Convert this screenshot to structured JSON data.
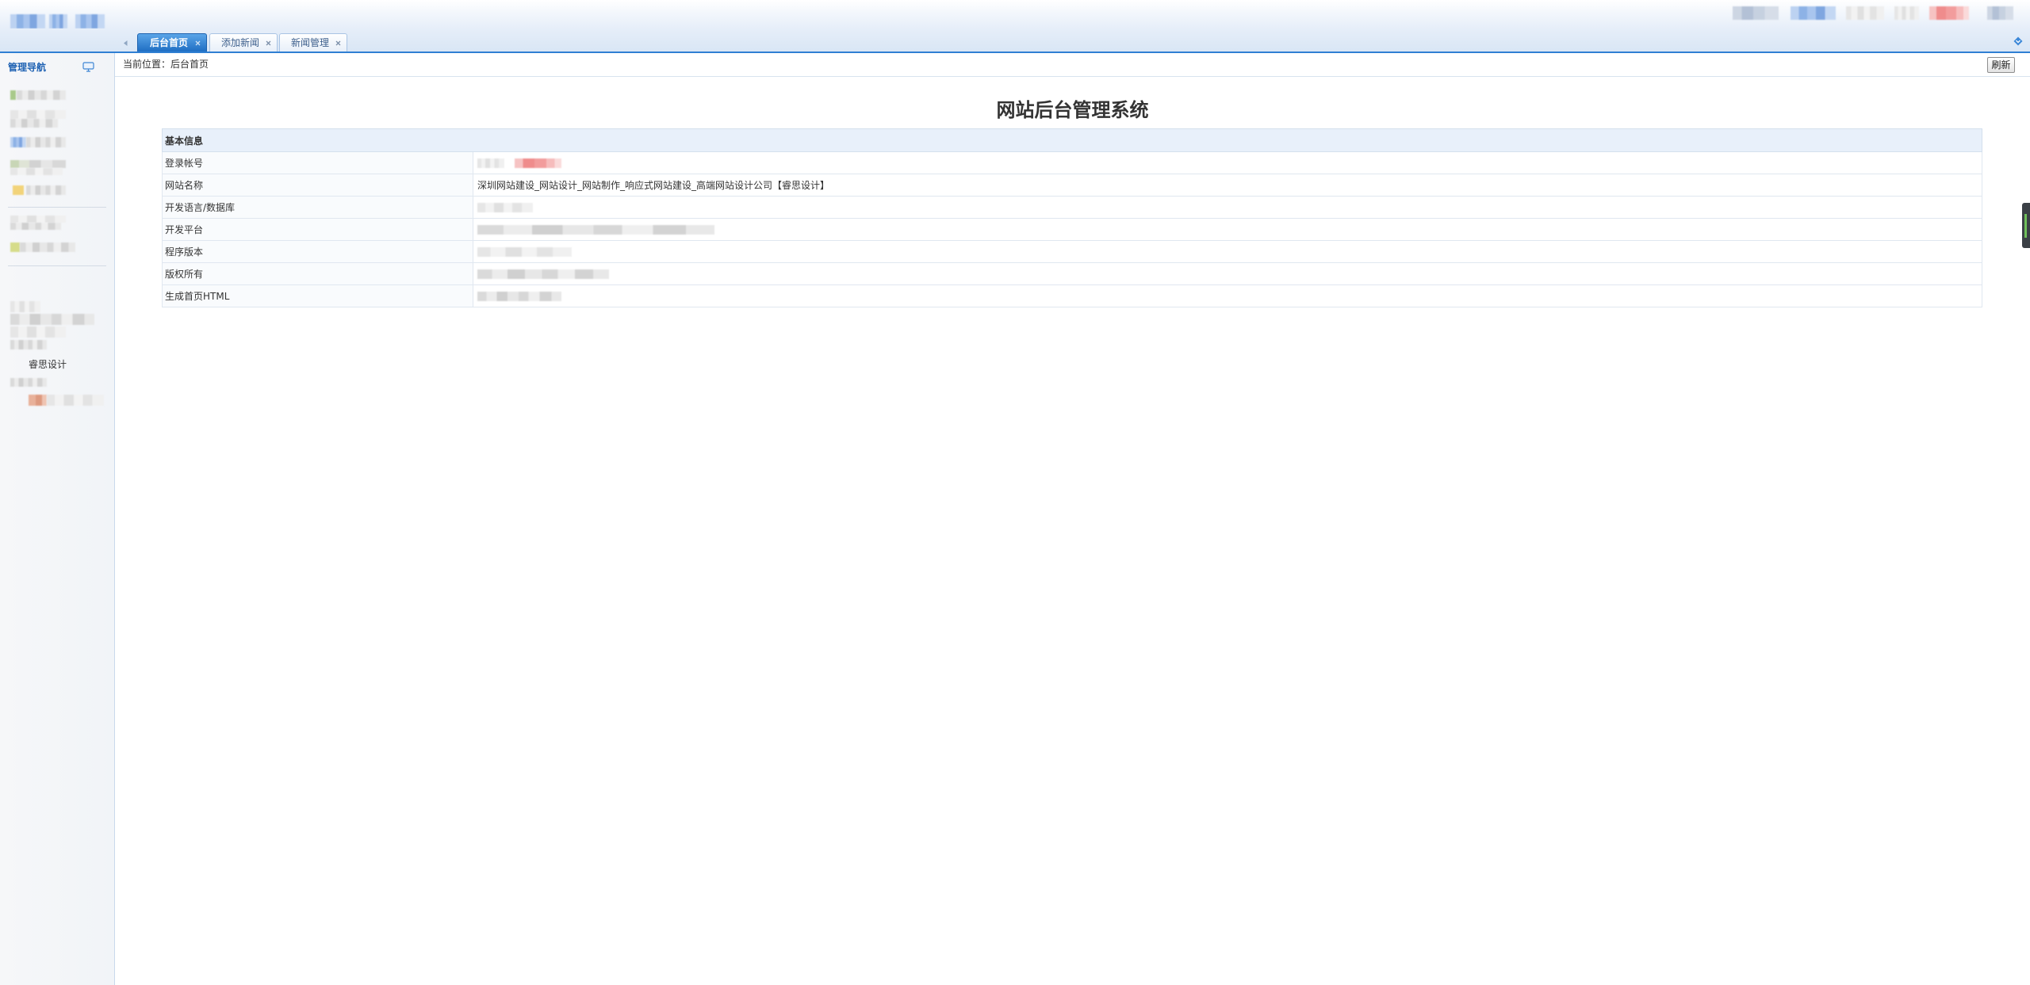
{
  "tabs": [
    {
      "label": "后台首页",
      "active": true
    },
    {
      "label": "添加新闻",
      "active": false
    },
    {
      "label": "新闻管理",
      "active": false
    }
  ],
  "sidebar": {
    "title": "管理导航",
    "info_text": "睿思设计"
  },
  "breadcrumb": {
    "text": "当前位置：后台首页"
  },
  "toolbar": {
    "refresh_label": "刷新"
  },
  "page_title": "网站后台管理系统",
  "info_table": {
    "header": "基本信息",
    "rows": [
      {
        "label": "登录帐号"
      },
      {
        "label": "网站名称",
        "value": "深圳网站建设_网站设计_网站制作_响应式网站建设_高端网站设计公司【睿思设计】"
      },
      {
        "label": "开发语言/数据库"
      },
      {
        "label": "开发平台"
      },
      {
        "label": "程序版本"
      },
      {
        "label": "版权所有"
      },
      {
        "label": "生成首页HTML"
      }
    ]
  },
  "icons": {
    "sidebar_toggle": "monitor-icon",
    "tab_scroll_left": "arrow-left-icon",
    "tab_scroll_right": "arrow-down-icon",
    "tab_close": "close-icon"
  },
  "colors": {
    "accent": "#2f7fd3",
    "active_tab": "#1f6ec3",
    "nav_title": "#1f62b3",
    "table_header_bg": "#e8f0fa"
  }
}
